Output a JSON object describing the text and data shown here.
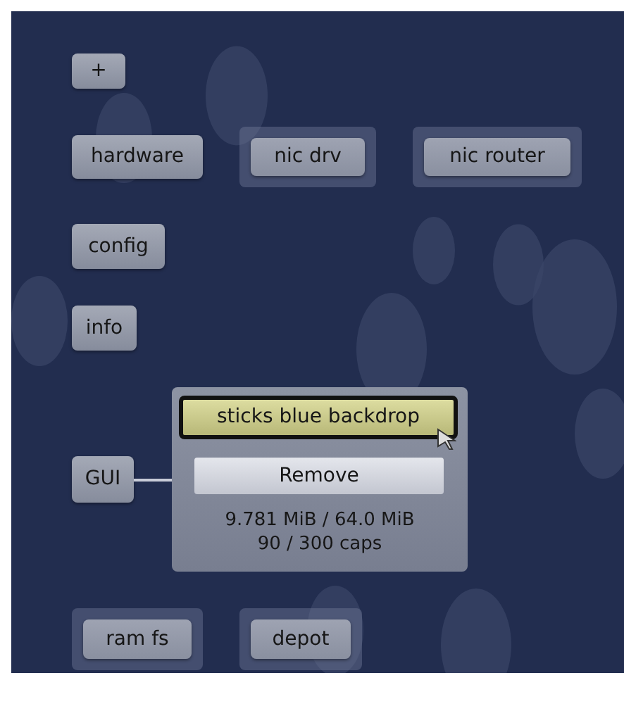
{
  "nodes": [
    {
      "label": "+",
      "kind": "plain"
    },
    {
      "label": "hardware",
      "kind": "plain"
    },
    {
      "label": "nic drv",
      "kind": "framed"
    },
    {
      "label": "nic router",
      "kind": "framed"
    },
    {
      "label": "config",
      "kind": "plain"
    },
    {
      "label": "info",
      "kind": "plain"
    },
    {
      "label": "GUI",
      "kind": "plain"
    },
    {
      "label": "ram fs",
      "kind": "framed"
    },
    {
      "label": "depot",
      "kind": "framed"
    }
  ],
  "popup": {
    "title": "sticks blue backdrop",
    "selected": true,
    "button": "Remove",
    "ram": "9.781 MiB / 64.0 MiB",
    "caps": "90 / 300 caps"
  }
}
